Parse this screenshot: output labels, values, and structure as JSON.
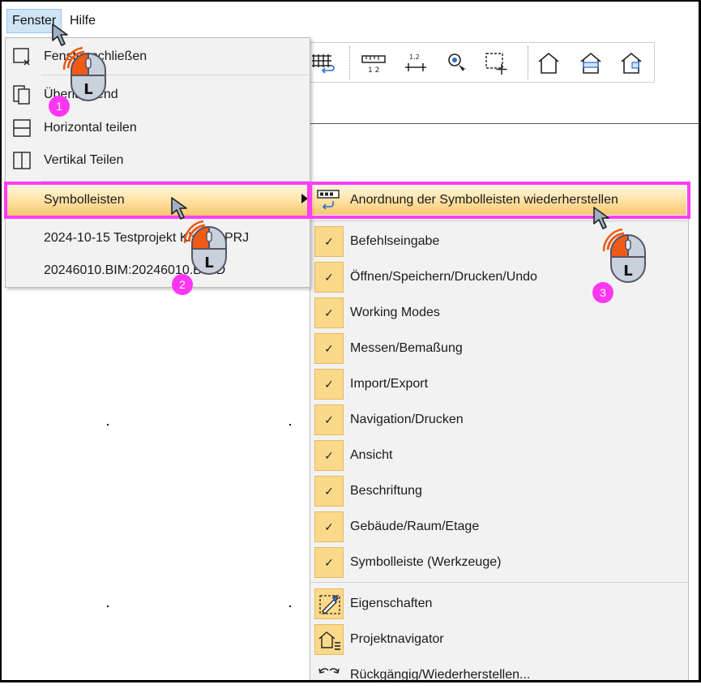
{
  "menubar": {
    "fenster": "Fenster",
    "hilfe": "Hilfe"
  },
  "fenster_menu": {
    "items": [
      {
        "label": "Fenster schließen",
        "icon": "window-close-icon"
      },
      {
        "label": "Überlappend",
        "icon": "overlap-icon"
      },
      {
        "label": "Horizontal teilen",
        "icon": "split-horizontal-icon"
      },
      {
        "label": "Vertikal Teilen",
        "icon": "split-vertical-icon"
      },
      {
        "label": "Symbolleisten",
        "icon": "",
        "has_submenu": true,
        "highlighted": true
      },
      {
        "label": "2024-10-15 Testprojekt Klassik.PRJ"
      },
      {
        "label": "20246010.BIM:20246010.BIMD"
      }
    ]
  },
  "symbolleisten_menu": {
    "restore": {
      "label": "Anordnung der Symbolleisten wiederherstellen",
      "icon": "toolbar-restore-icon"
    },
    "checked_items": [
      "Befehlseingabe",
      "Öffnen/Speichern/Drucken/Undo",
      "Working Modes",
      "Messen/Bemaßung",
      "Import/Export",
      "Navigation/Drucken",
      "Ansicht",
      "Beschriftung",
      "Gebäude/Raum/Etage",
      "Symbolleiste (Werkzeuge)"
    ],
    "check_mark": "✓",
    "panel_items": [
      {
        "label": "Eigenschaften",
        "icon": "properties-icon"
      },
      {
        "label": "Projektnavigator",
        "icon": "project-navigator-icon"
      },
      {
        "label": "Rückgängig/Wiederherstellen...",
        "icon": "undo-redo-icon"
      }
    ]
  },
  "annotations": {
    "step1": "1",
    "step2": "2",
    "step3": "3",
    "mouse_button": "L",
    "highlight_color": "#ff3df5",
    "menu_highlight_color": "#ffe1a1",
    "checkbox_color": "#fbd98b"
  },
  "toolbar_icons": [
    "grid-icon",
    "measure-icon",
    "dimension-icon",
    "snap-point-icon",
    "selection-move-icon",
    "house-icon",
    "house-level-icon",
    "house-room-icon"
  ]
}
